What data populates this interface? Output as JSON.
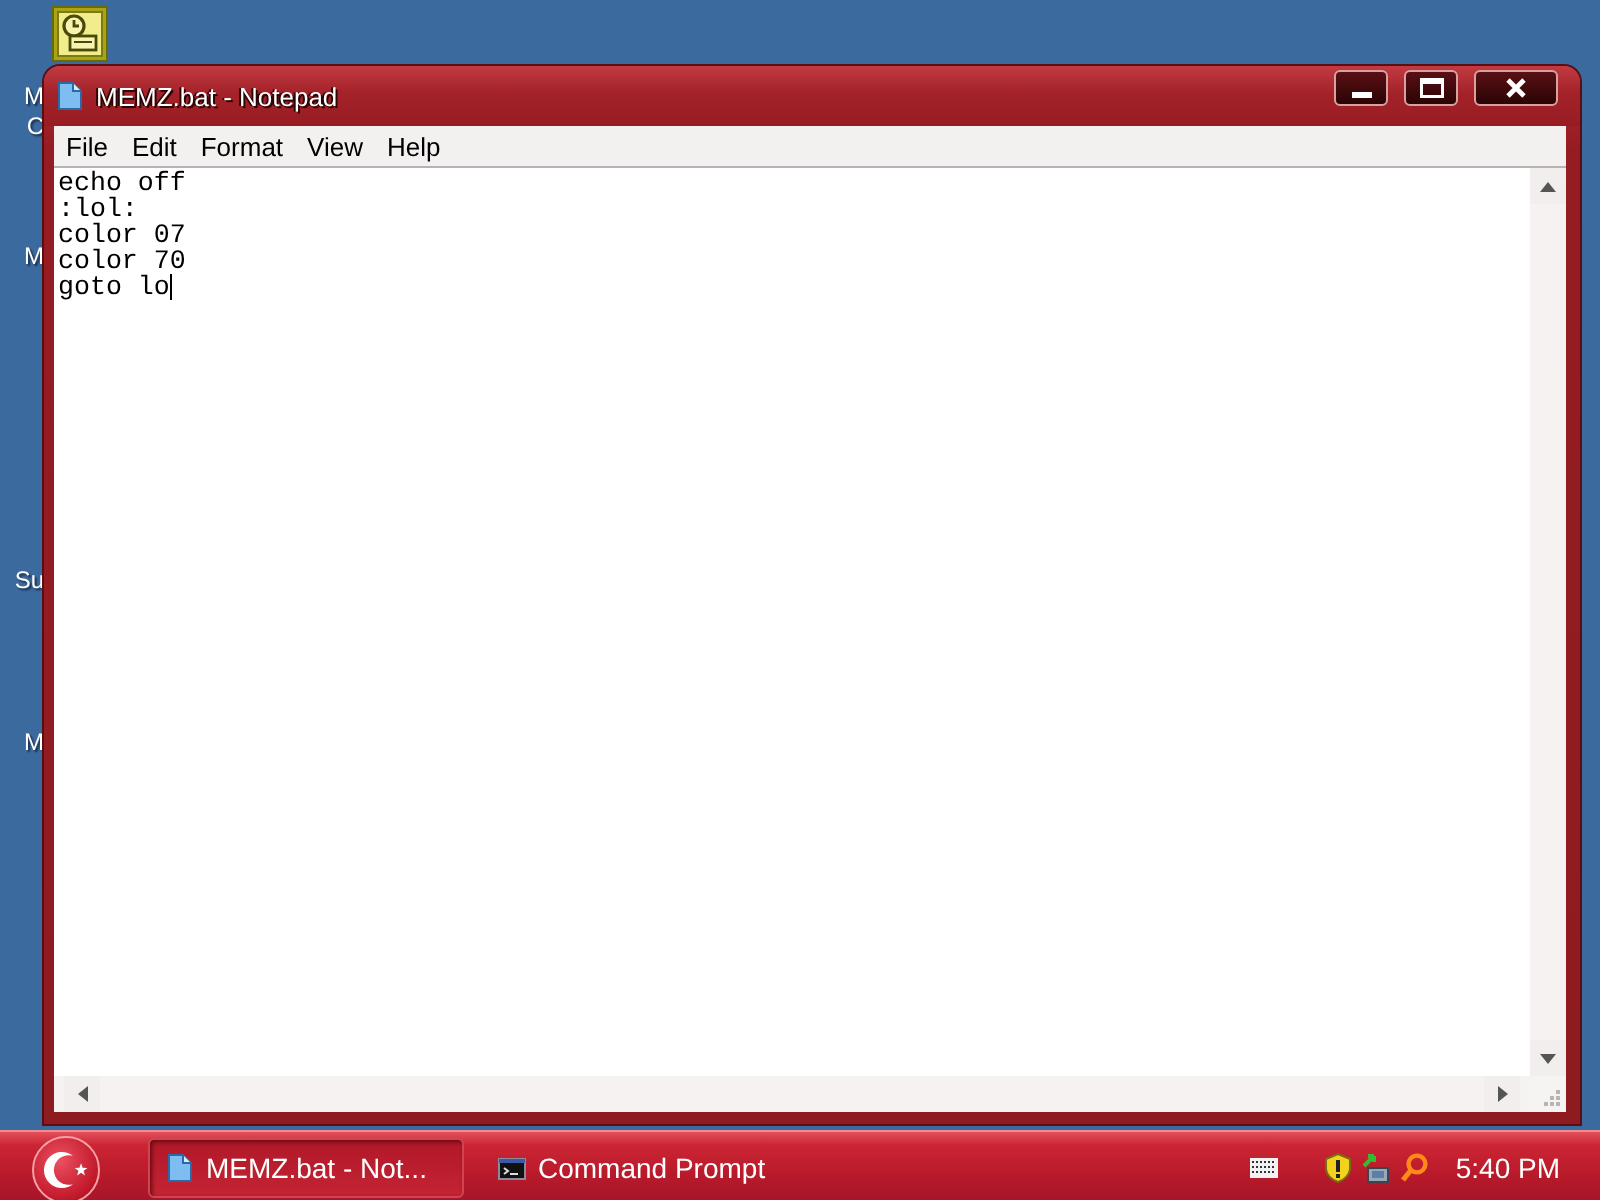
{
  "desktop": {
    "icons": [
      {
        "kind": "shortcut",
        "label_lines": [
          "M",
          "C"
        ]
      },
      {
        "kind": "covered",
        "label_lines": [
          "M"
        ]
      },
      {
        "kind": "covered",
        "label_lines": [
          "Su"
        ]
      },
      {
        "kind": "covered",
        "label_lines": [
          "M"
        ]
      }
    ]
  },
  "window": {
    "title": "MEMZ.bat - Notepad",
    "menu": [
      "File",
      "Edit",
      "Format",
      "View",
      "Help"
    ],
    "document": {
      "lines": [
        "echo off",
        ":lol:",
        "color 07",
        "color 70",
        "goto lo"
      ]
    }
  },
  "taskbar": {
    "buttons": [
      {
        "kind": "notepad",
        "label": "MEMZ.bat - Not...",
        "selected": true
      },
      {
        "kind": "console",
        "label": "Command Prompt",
        "selected": false
      }
    ],
    "clock": "5:40 PM"
  }
}
